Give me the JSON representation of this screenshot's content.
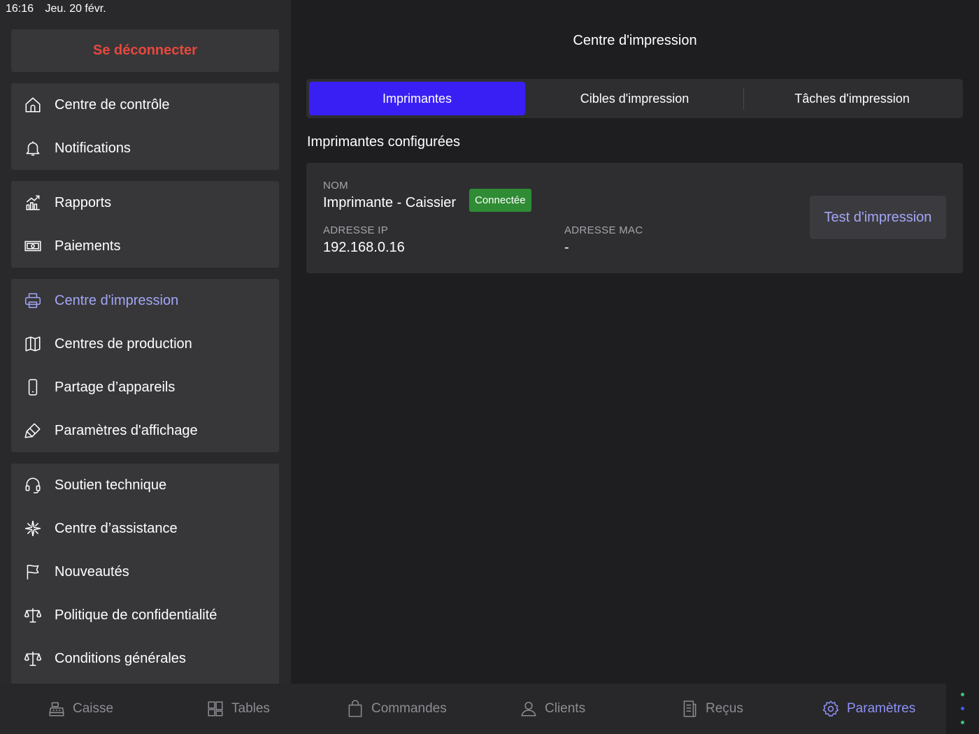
{
  "status_bar": {
    "time": "16:16",
    "date": "Jeu. 20 févr."
  },
  "sidebar": {
    "logout_label": "Se déconnecter",
    "groups": [
      {
        "items": [
          {
            "label": "Centre de contrôle",
            "icon": "home-icon"
          },
          {
            "label": "Notifications",
            "icon": "bell-icon"
          }
        ]
      },
      {
        "items": [
          {
            "label": "Rapports",
            "icon": "chart-icon"
          },
          {
            "label": "Paiements",
            "icon": "cash-icon"
          }
        ]
      },
      {
        "items": [
          {
            "label": "Centre d'impression",
            "icon": "printer-icon",
            "active": true
          },
          {
            "label": "Centres de production",
            "icon": "map-icon"
          },
          {
            "label": "Partage d’appareils",
            "icon": "phone-icon"
          },
          {
            "label": "Paramètres d'affichage",
            "icon": "paint-icon"
          }
        ]
      },
      {
        "items": [
          {
            "label": "Soutien technique",
            "icon": "headset-icon"
          },
          {
            "label": "Centre d’assistance",
            "icon": "sparkle-icon"
          },
          {
            "label": "Nouveautés",
            "icon": "flag-icon"
          },
          {
            "label": "Politique de confidentialité",
            "icon": "scale-icon"
          },
          {
            "label": "Conditions générales",
            "icon": "scale-icon"
          }
        ]
      }
    ]
  },
  "main": {
    "title": "Centre d'impression",
    "tabs": [
      {
        "label": "Imprimantes",
        "active": true
      },
      {
        "label": "Cibles d'impression"
      },
      {
        "label": "Tâches d'impression"
      }
    ],
    "section_title": "Imprimantes configurées",
    "printer": {
      "name_label": "NOM",
      "name": "Imprimante - Caissier",
      "status": "Connectée",
      "ip_label": "ADRESSE IP",
      "ip": "192.168.0.16",
      "mac_label": "ADRESSE MAC",
      "mac": "-",
      "test_button": "Test d'impression"
    }
  },
  "tabbar": {
    "tabs": [
      {
        "label": "Caisse",
        "icon": "register-icon"
      },
      {
        "label": "Tables",
        "icon": "tables-icon"
      },
      {
        "label": "Commandes",
        "icon": "bag-icon"
      },
      {
        "label": "Clients",
        "icon": "user-icon"
      },
      {
        "label": "Reçus",
        "icon": "receipt-icon"
      },
      {
        "label": "Paramètres",
        "icon": "gear-icon",
        "active": true
      }
    ]
  },
  "colors": {
    "accent": "#3a1ff5",
    "active_text": "#a3a6f6",
    "danger": "#e8483b",
    "success": "#2f8c34",
    "dots": [
      "#3fbf7a",
      "#3a5cf5",
      "#3fbf7a"
    ]
  }
}
